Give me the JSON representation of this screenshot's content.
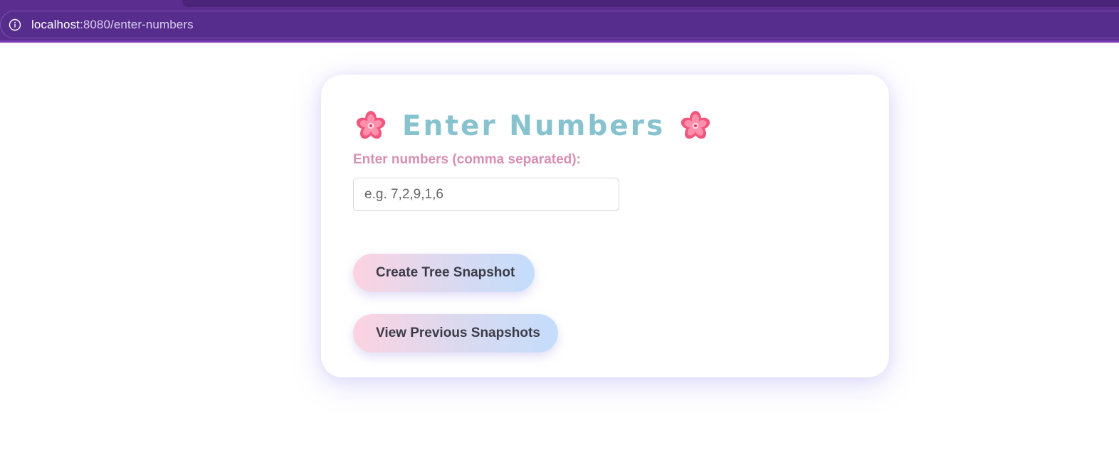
{
  "browser": {
    "url_host": "localhost",
    "url_path": ":8080/enter-numbers",
    "site_info_icon": "info-circle-icon",
    "colors": {
      "chrome": "#5a2d8f",
      "address_bar": "#562c8c"
    }
  },
  "page": {
    "title": "Enter Numbers",
    "title_icon": "cherry-blossom-icon",
    "label": "Enter numbers (comma separated):",
    "input": {
      "placeholder": "e.g. 7,2,9,1,6",
      "value": ""
    },
    "buttons": {
      "create": "Create Tree Snapshot",
      "view": "View Previous Snapshots"
    },
    "colors": {
      "title": "#87c2cf",
      "label": "#d88fb5",
      "button_gradient_start": "#fcd3e1",
      "button_gradient_end": "#c3ddfb"
    }
  }
}
